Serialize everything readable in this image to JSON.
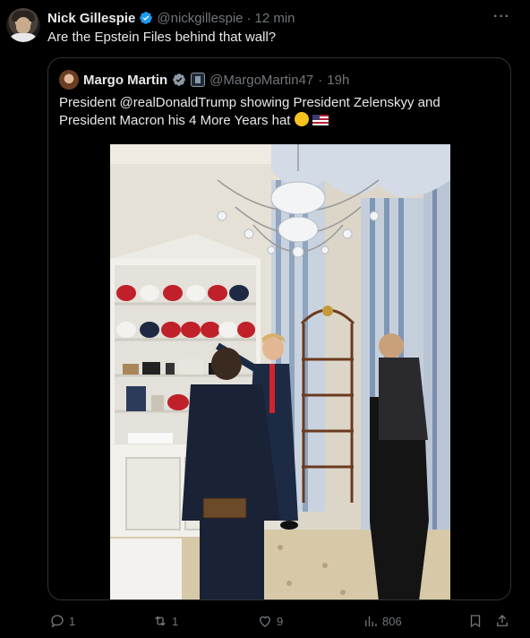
{
  "tweet": {
    "author_name": "Nick Gillespie",
    "author_handle": "@nickgillespie",
    "separator": "·",
    "time": "12 min",
    "more": "···",
    "text": "Are the Epstein Files behind that wall?"
  },
  "quote": {
    "author_name": "Margo Martin",
    "author_handle": "@MargoMartin47",
    "separator": "·",
    "time": "19h",
    "text": "President @realDonaldTrump showing President Zelenskyy and President Macron his 4 More Years hat"
  },
  "actions": {
    "replies": "1",
    "reposts": "1",
    "likes": "9",
    "views": "806"
  },
  "colors": {
    "background": "#000000",
    "text": "#e7e9ea",
    "muted": "#71767b",
    "verified": "#1d9bf0",
    "border": "#2f3336"
  }
}
